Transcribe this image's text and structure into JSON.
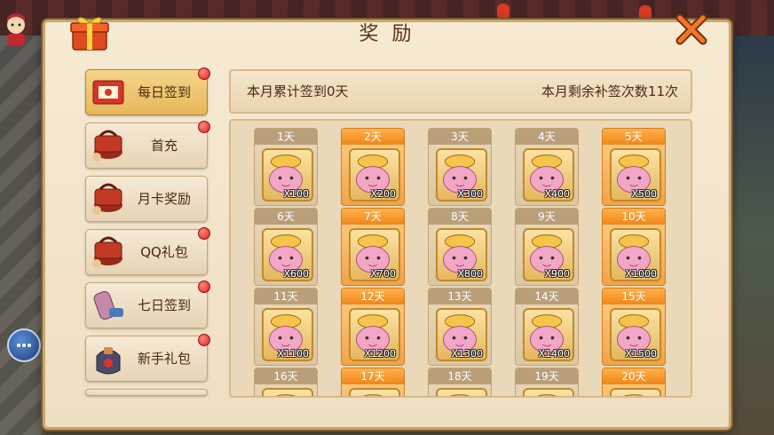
{
  "panel": {
    "title": "奖 励"
  },
  "menu": [
    {
      "label": "每日签到",
      "active": true,
      "icon": "daily-signin-icon",
      "dot": true
    },
    {
      "label": "首充",
      "active": false,
      "icon": "first-recharge-icon",
      "dot": true
    },
    {
      "label": "月卡奖励",
      "active": false,
      "icon": "monthly-card-icon",
      "dot": false
    },
    {
      "label": "QQ礼包",
      "active": false,
      "icon": "qq-gift-icon",
      "dot": true
    },
    {
      "label": "七日签到",
      "active": false,
      "icon": "seven-day-icon",
      "dot": true
    },
    {
      "label": "新手礼包",
      "active": false,
      "icon": "newbie-gift-icon",
      "dot": true
    }
  ],
  "info": {
    "signed_text": "本月累计签到0天",
    "remaining_text": "本月剩余补签次数11次"
  },
  "days": [
    {
      "day": "1天",
      "qty": "X100",
      "orange": false
    },
    {
      "day": "2天",
      "qty": "X200",
      "orange": true
    },
    {
      "day": "3天",
      "qty": "X300",
      "orange": false
    },
    {
      "day": "4天",
      "qty": "X400",
      "orange": false
    },
    {
      "day": "5天",
      "qty": "X500",
      "orange": true
    },
    {
      "day": "6天",
      "qty": "X600",
      "orange": false
    },
    {
      "day": "7天",
      "qty": "X700",
      "orange": true
    },
    {
      "day": "8天",
      "qty": "X800",
      "orange": false
    },
    {
      "day": "9天",
      "qty": "X900",
      "orange": false
    },
    {
      "day": "10天",
      "qty": "X1000",
      "orange": true
    },
    {
      "day": "11天",
      "qty": "X1100",
      "orange": false
    },
    {
      "day": "12天",
      "qty": "X1200",
      "orange": true
    },
    {
      "day": "13天",
      "qty": "X1300",
      "orange": false
    },
    {
      "day": "14天",
      "qty": "X1400",
      "orange": false
    },
    {
      "day": "15天",
      "qty": "X1500",
      "orange": true
    },
    {
      "day": "16天",
      "qty": "",
      "orange": false
    },
    {
      "day": "17天",
      "qty": "",
      "orange": true
    },
    {
      "day": "18天",
      "qty": "",
      "orange": false
    },
    {
      "day": "19天",
      "qty": "",
      "orange": false
    },
    {
      "day": "20天",
      "qty": "",
      "orange": true
    }
  ],
  "colors": {
    "panel_bg": "#f6ead3",
    "active_tab": "#f6d58a",
    "orange_card": "#f3a445",
    "text_brown": "#4a2a12"
  }
}
